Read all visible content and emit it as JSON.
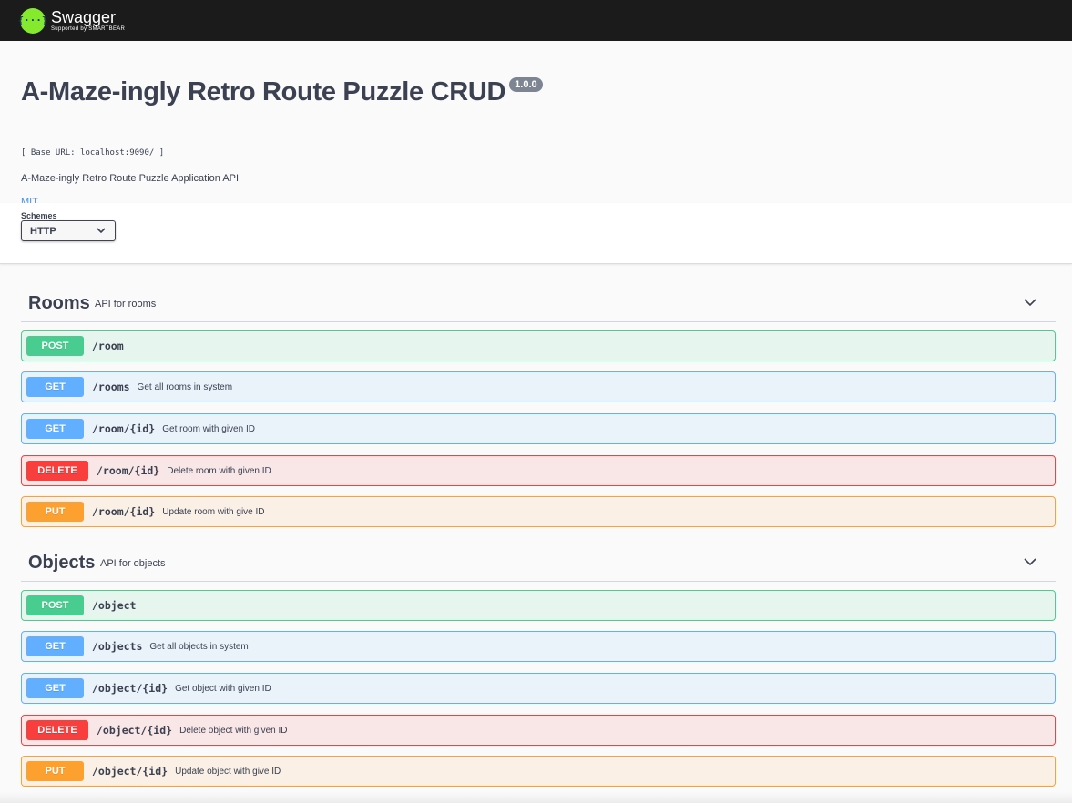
{
  "topbar": {
    "logo_glyph": "{···}",
    "logo_name": "Swagger",
    "logo_sub": "Supported by SMARTBEAR"
  },
  "info": {
    "title": "A-Maze-ingly Retro Route Puzzle CRUD",
    "version": "1.0.0",
    "base_url": "[ Base URL: localhost:9090/ ]",
    "description": "A-Maze-ingly Retro Route Puzzle Application API",
    "license": "MIT"
  },
  "schemes": {
    "label": "Schemes",
    "selected": "HTTP"
  },
  "tags": [
    {
      "name": "Rooms",
      "description": "API for rooms",
      "operations": [
        {
          "method": "POST",
          "path": "/room",
          "summary": ""
        },
        {
          "method": "GET",
          "path": "/rooms",
          "summary": "Get all rooms in system"
        },
        {
          "method": "GET",
          "path": "/room/{id}",
          "summary": "Get room with given ID"
        },
        {
          "method": "DELETE",
          "path": "/room/{id}",
          "summary": "Delete room with given ID"
        },
        {
          "method": "PUT",
          "path": "/room/{id}",
          "summary": "Update room with give ID"
        }
      ]
    },
    {
      "name": "Objects",
      "description": "API for objects",
      "operations": [
        {
          "method": "POST",
          "path": "/object",
          "summary": ""
        },
        {
          "method": "GET",
          "path": "/objects",
          "summary": "Get all objects in system"
        },
        {
          "method": "GET",
          "path": "/object/{id}",
          "summary": "Get object with given ID"
        },
        {
          "method": "DELETE",
          "path": "/object/{id}",
          "summary": "Delete object with given ID"
        },
        {
          "method": "PUT",
          "path": "/object/{id}",
          "summary": "Update object with give ID"
        }
      ]
    }
  ],
  "colors": {
    "post": "#49cc90",
    "get": "#61affe",
    "delete": "#f93e3e",
    "put": "#fca130",
    "topbar": "#1b1b1b",
    "logo": "#85ea2d"
  }
}
